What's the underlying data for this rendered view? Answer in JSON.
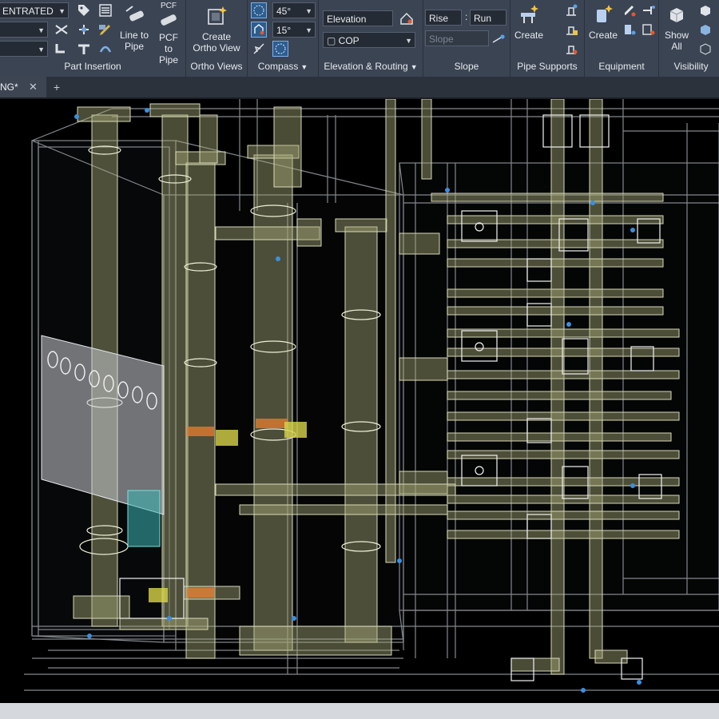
{
  "ribbon": {
    "part_insertion": {
      "title": "Part Insertion",
      "spec_combo_value": "ENTRATED",
      "line_to_pipe_label": "Line to Pipe",
      "pcf_to_pipe_label": "PCF to Pipe",
      "pcf_badge": "PCF"
    },
    "ortho_views": {
      "title": "Ortho Views",
      "create_label": "Create Ortho View"
    },
    "compass": {
      "title": "Compass",
      "angle_1": "45°",
      "angle_2": "15°"
    },
    "elevation_routing": {
      "title": "Elevation & Routing",
      "elevation_placeholder": "Elevation",
      "cop_value": "COP"
    },
    "slope": {
      "title": "Slope",
      "rise_label": "Rise",
      "separator": ":",
      "run_label": "Run",
      "slope_placeholder": "Slope"
    },
    "pipe_supports": {
      "title": "Pipe Supports",
      "create_label": "Create"
    },
    "equipment": {
      "title": "Equipment",
      "create_label": "Create"
    },
    "visibility": {
      "title": "Visibility",
      "show_all_label": "Show All"
    }
  },
  "tabs": {
    "document_tab": "NG*",
    "close_glyph": "✕",
    "new_tab_glyph": "+"
  },
  "colors": {
    "pipe": "#a7a877",
    "frame": "#9aa0a6",
    "valve": "#f2f2f2",
    "accent_orange": "#e07a2e",
    "accent_teal": "#3ab7b7",
    "flag_yellow": "#d8d44a"
  }
}
